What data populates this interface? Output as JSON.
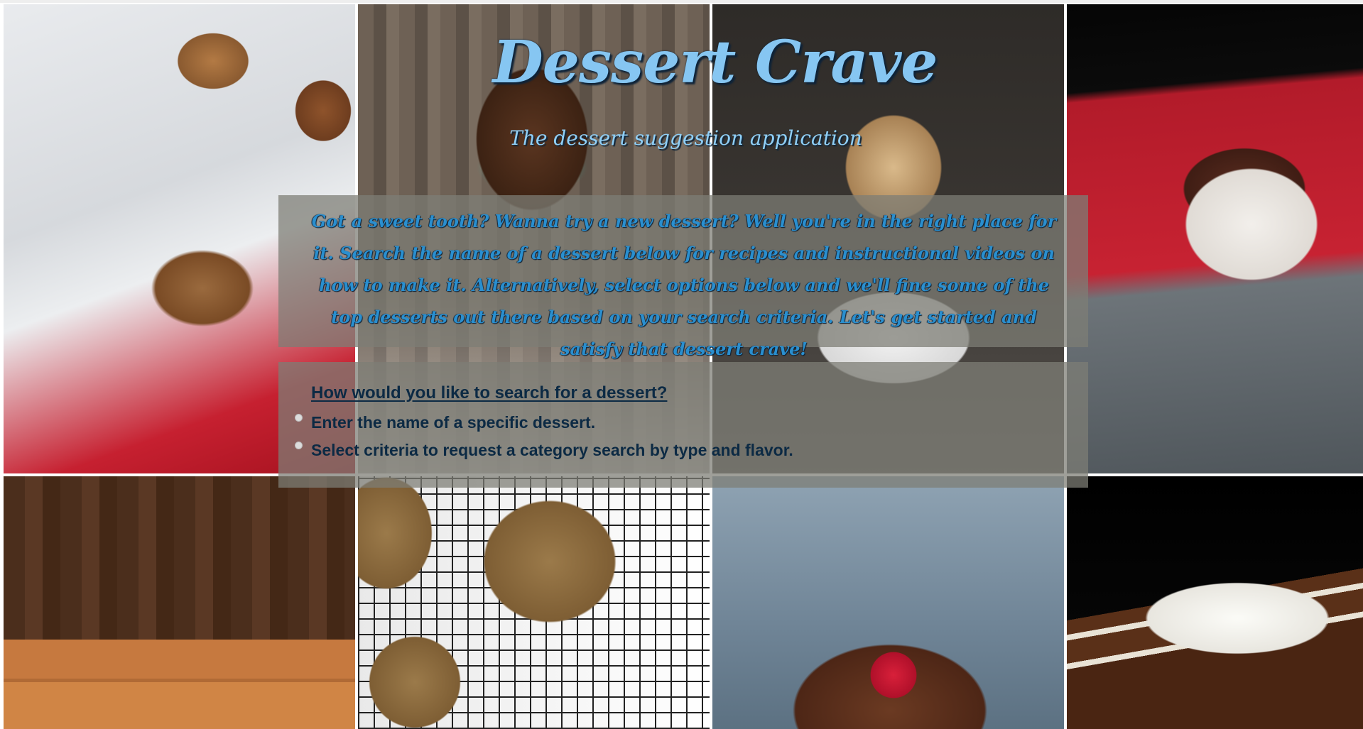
{
  "header": {
    "title": "Dessert Crave",
    "subtitle": "The dessert suggestion application"
  },
  "intro": {
    "text": "Got a sweet tooth? Wanna try a new dessert? Well you're in the right place for it. Search the name of a dessert below for recipes and instructional videos on how to make it. Alternatively, select options below and we'll fine some of the top desserts out there based on your search criteria. Let's get started and satisfy that dessert crave!"
  },
  "search_options": {
    "heading": "How would you like to search for a dessert?",
    "items": [
      {
        "label": "Enter the name of a specific dessert."
      },
      {
        "label": "Select criteria to request a category search by type and flavor."
      }
    ]
  },
  "background_images": [
    "muffins-with-cinnamon",
    "chocolate-ice-cream-cone",
    "ice-cream-scoop-in-glass",
    "chocolate-fudge-bowl",
    "fudge-squares",
    "glazed-oatmeal-cookies",
    "chocolate-pudding-with-raspberry",
    "layered-cake-slice"
  ],
  "colors": {
    "title": "#86c6f2",
    "intro_text": "#2a8fcf",
    "options_text": "#0c2a44",
    "panel_overlay": "rgba(125,125,118,0.74)"
  }
}
